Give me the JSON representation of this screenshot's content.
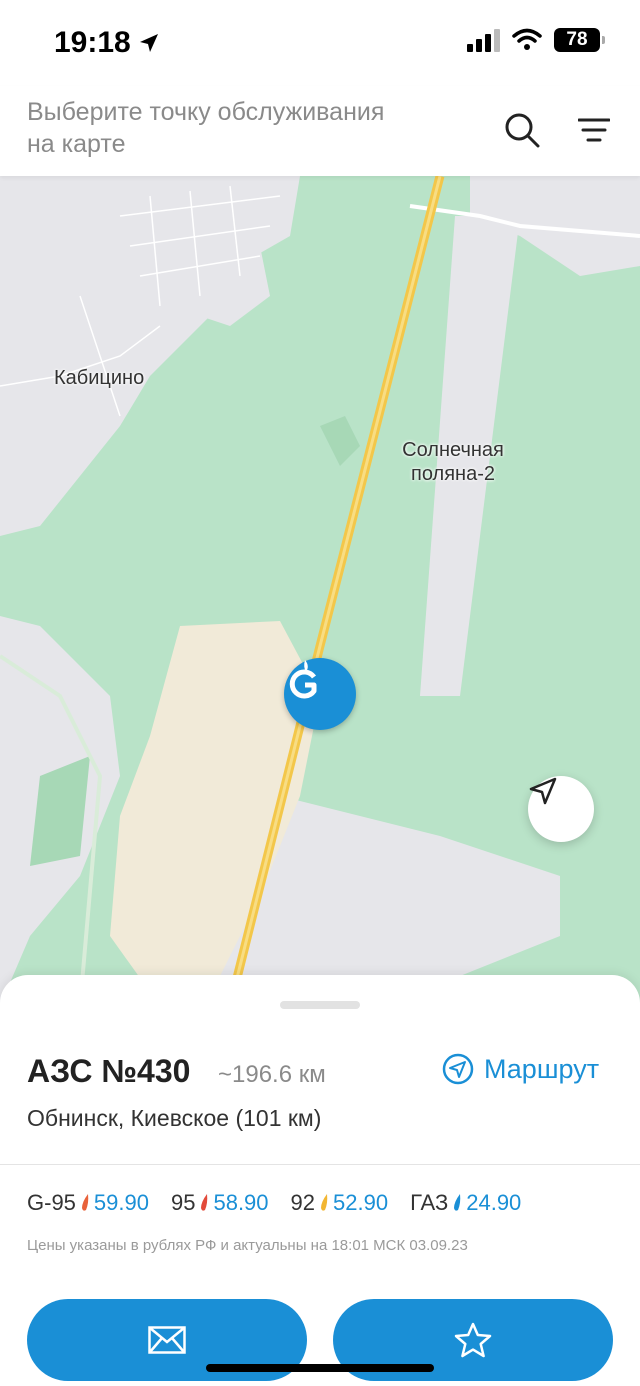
{
  "status_bar": {
    "time": "19:18",
    "battery": "78"
  },
  "header": {
    "title": "Выберите точку обслуживания на карте",
    "search_icon": "search-icon",
    "filter_icon": "filter-icon"
  },
  "map": {
    "labels": {
      "kabitsino": "Кабицино",
      "solnechnaya": "Солнечная поляна-2"
    },
    "marker_brand": "gazprom-g-icon"
  },
  "station": {
    "title": "АЗС №430",
    "distance": "~196.6 км",
    "route_label": "Маршрут",
    "address": "Обнинск, Киевское (101 км)"
  },
  "prices": [
    {
      "name": "G-95",
      "value": "59.90",
      "drop_color": "#e8623a"
    },
    {
      "name": "95",
      "value": "58.90",
      "drop_color": "#e24a3a"
    },
    {
      "name": "92",
      "value": "52.90",
      "drop_color": "#f2b632"
    },
    {
      "name": "ГАЗ",
      "value": "24.90",
      "drop_color": "#1a8fd6"
    }
  ],
  "price_note": "Цены указаны в рублях РФ и актуальны на 18:01 МСК 03.09.23",
  "colors": {
    "accent": "#1a8fd6",
    "map_green": "#b9e3c8",
    "road_yellow": "#f3c74a"
  }
}
